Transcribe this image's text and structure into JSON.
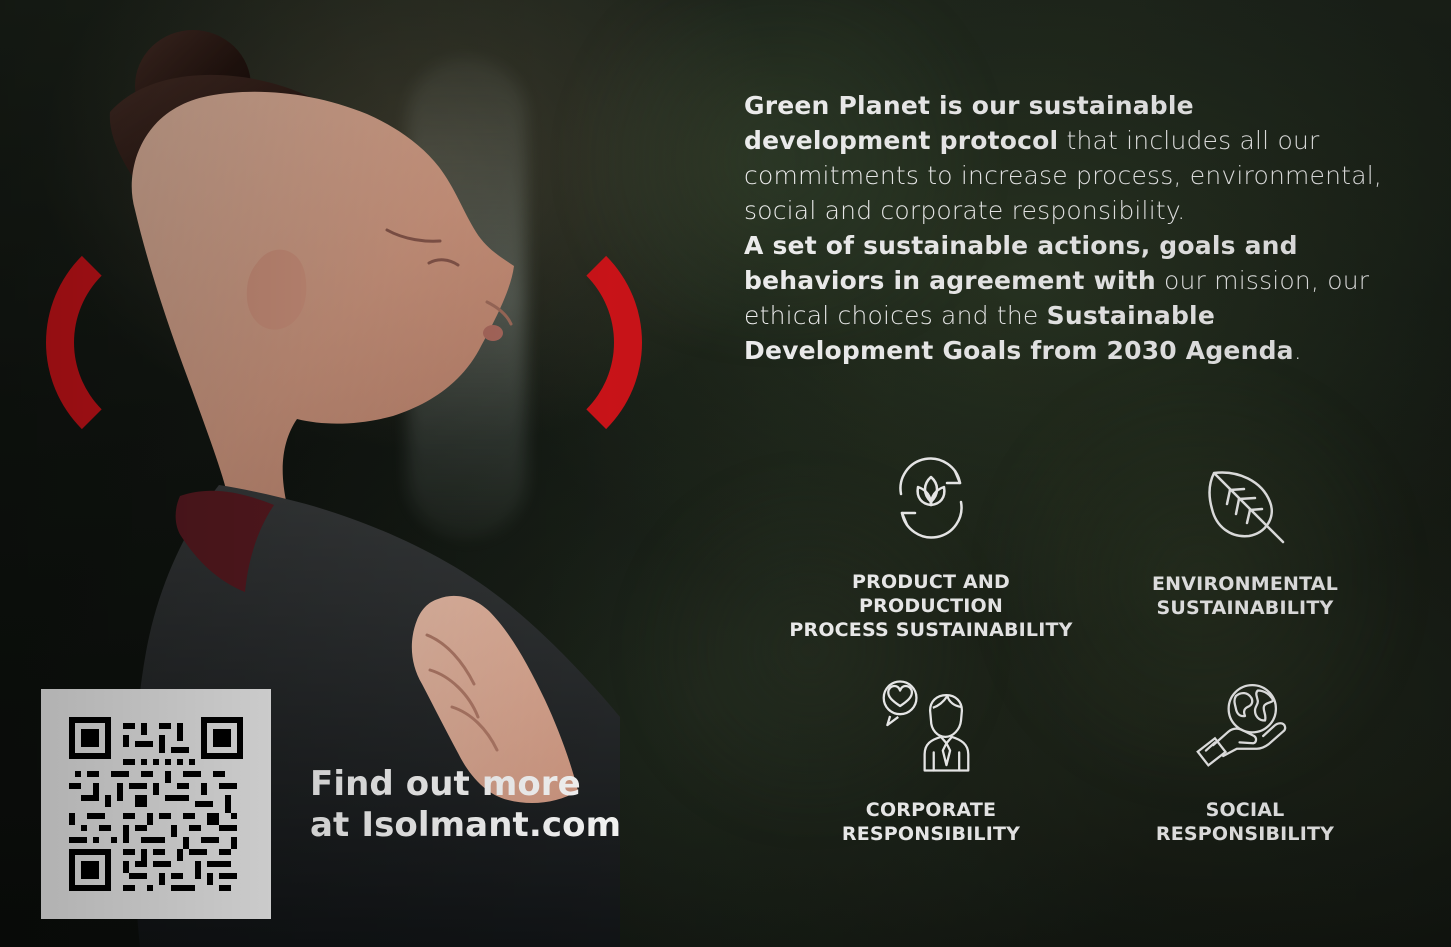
{
  "intro": {
    "p1_bold": "Green Planet is our sustainable development protocol",
    "p1_text": " that includes all our commitments to increase process, environmental, social and corporate responsibility.",
    "p2_bold": "A set of sustainable actions, goals and behaviors in agreement with",
    "p2_text": " our mission, our ethical choices and the ",
    "p2_bold2": "Sustainable Development Goals from 2030 Agenda",
    "p2_end": "."
  },
  "features": {
    "product": {
      "line1": "PRODUCT AND PRODUCTION",
      "line2": "PROCESS SUSTAINABILITY"
    },
    "environment": {
      "line1": "ENVIRONMENTAL",
      "line2": "SUSTAINABILITY"
    },
    "corporate": {
      "line1": "CORPORATE",
      "line2": "RESPONSIBILITY"
    },
    "social": {
      "line1": "SOCIAL",
      "line2": "RESPONSIBILITY"
    }
  },
  "cta": {
    "line1": "Find out more",
    "line2": "at Isolmant.com"
  },
  "colors": {
    "accent": "#d4141a",
    "text": "#ffffff"
  },
  "icons": {
    "product": "leaf-recycle-icon",
    "environment": "leaf-icon",
    "corporate": "business-person-heart-icon",
    "social": "hand-earth-icon"
  }
}
